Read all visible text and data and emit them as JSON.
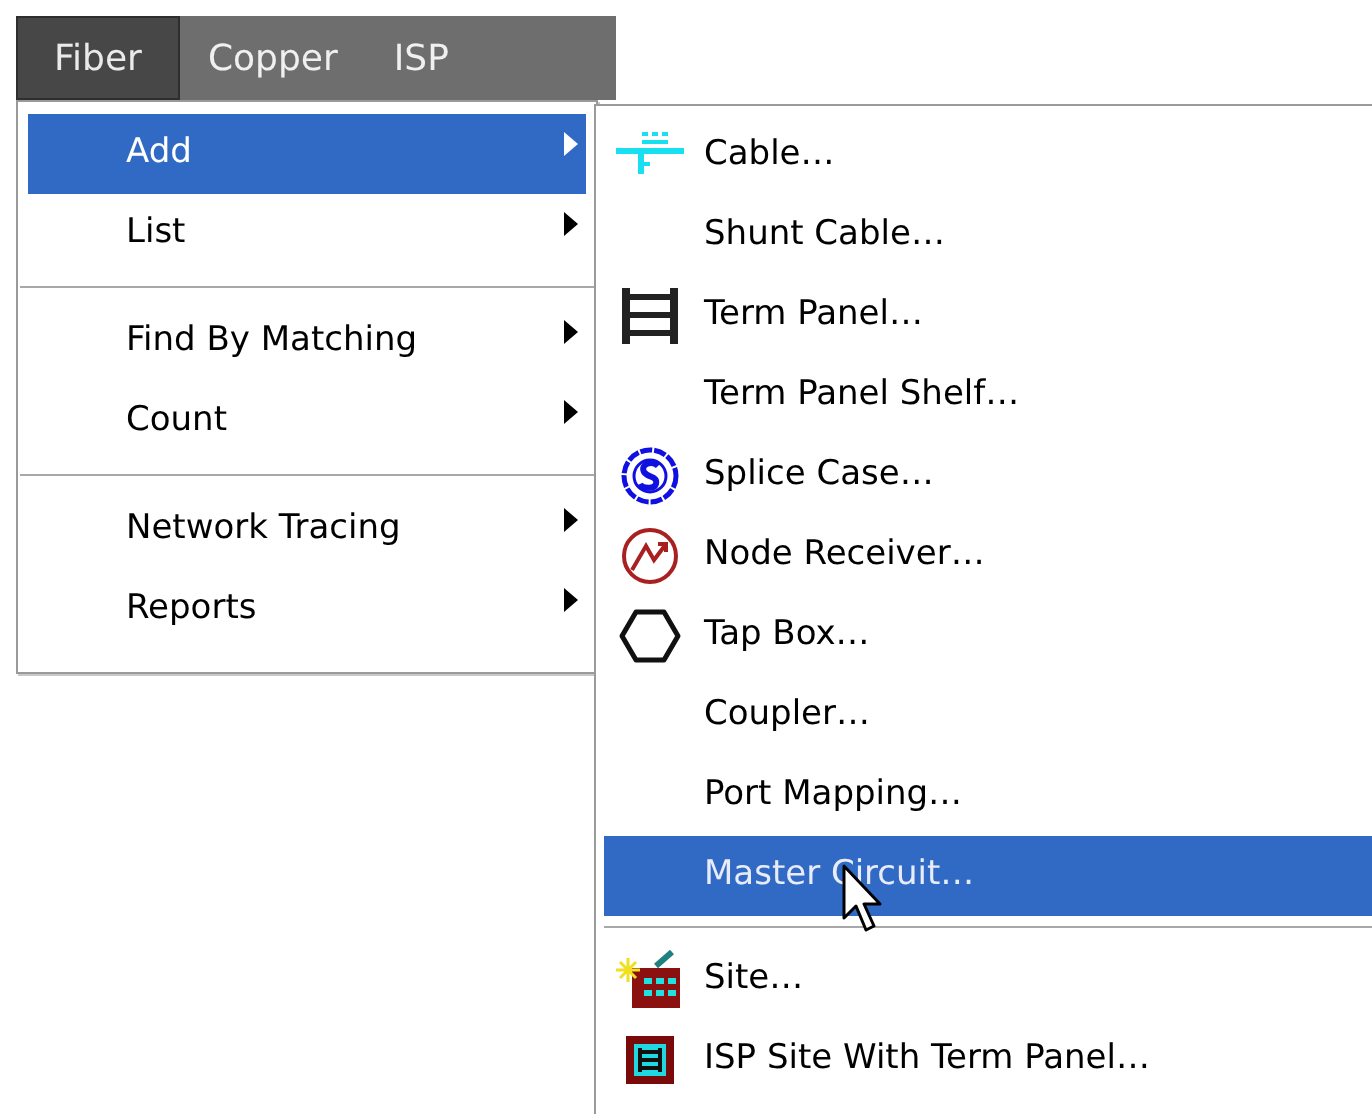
{
  "menubar": [
    {
      "label": "Fiber",
      "selected": true
    },
    {
      "label": "Copper",
      "selected": false
    },
    {
      "label": "ISP",
      "selected": false
    }
  ],
  "menu": [
    {
      "label": "Add",
      "submenu": true,
      "selected": true,
      "separator_before": false
    },
    {
      "label": "List",
      "submenu": true,
      "selected": false,
      "separator_before": false
    },
    {
      "label": "Find By Matching",
      "submenu": true,
      "selected": false,
      "separator_before": true
    },
    {
      "label": "Count",
      "submenu": true,
      "selected": false,
      "separator_before": false
    },
    {
      "label": "Network Tracing",
      "submenu": true,
      "selected": false,
      "separator_before": true
    },
    {
      "label": "Reports",
      "submenu": true,
      "selected": false,
      "separator_before": false
    }
  ],
  "submenu": [
    {
      "label": "Cable…",
      "kind": "cable",
      "selected": false,
      "separator_before": false
    },
    {
      "label": "Shunt Cable…",
      "kind": "plain",
      "selected": false,
      "separator_before": false
    },
    {
      "label": "Term Panel…",
      "kind": "term-panel",
      "selected": false,
      "separator_before": false
    },
    {
      "label": "Term Panel Shelf…",
      "kind": "plain",
      "selected": false,
      "separator_before": false
    },
    {
      "label": "Splice Case…",
      "kind": "splice-case",
      "selected": false,
      "separator_before": false
    },
    {
      "label": "Node Receiver…",
      "kind": "node-receiver",
      "selected": false,
      "separator_before": false
    },
    {
      "label": "Tap Box…",
      "kind": "tap-box",
      "selected": false,
      "separator_before": false
    },
    {
      "label": "Coupler…",
      "kind": "plain",
      "selected": false,
      "separator_before": false
    },
    {
      "label": "Port Mapping…",
      "kind": "plain",
      "selected": false,
      "separator_before": false
    },
    {
      "label": "Master Circuit…",
      "kind": "plain",
      "selected": true,
      "separator_before": false
    },
    {
      "label": "Site…",
      "kind": "site",
      "selected": false,
      "separator_before": true
    },
    {
      "label": "ISP Site With Term Panel…",
      "kind": "isp-site",
      "selected": false,
      "separator_before": false
    }
  ]
}
